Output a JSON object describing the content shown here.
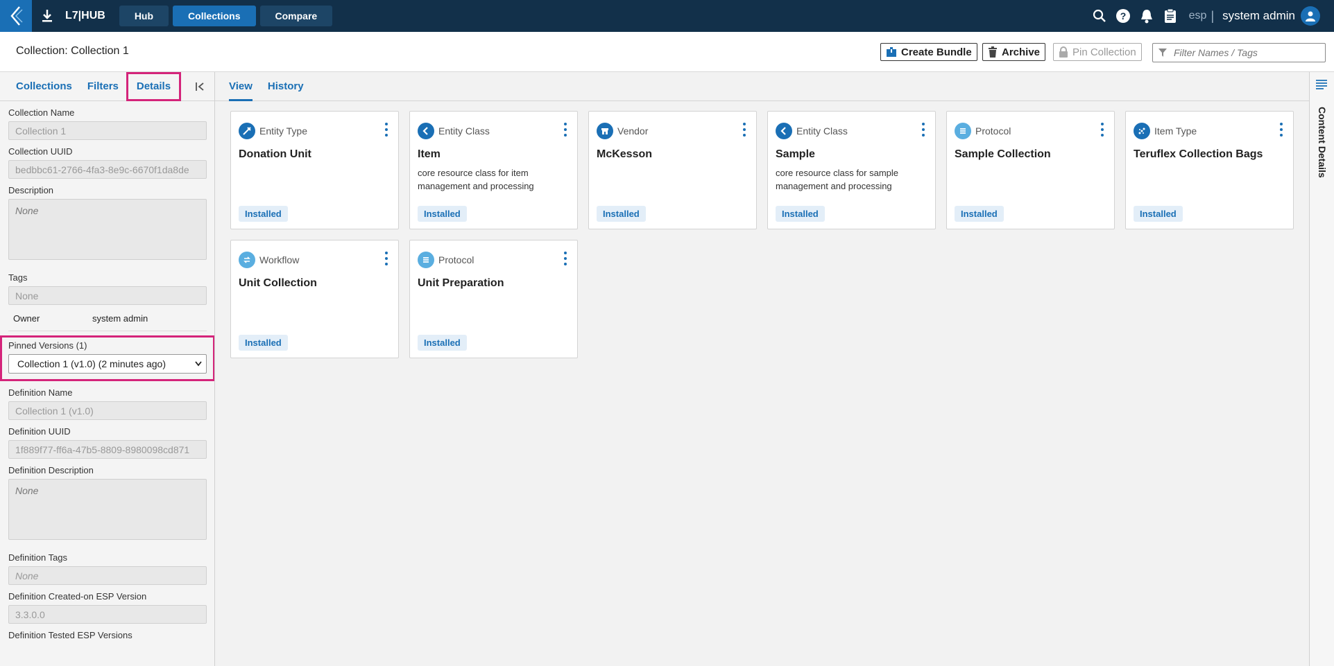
{
  "nav": {
    "brand": "L7|HUB",
    "tabs": [
      {
        "label": "Hub"
      },
      {
        "label": "Collections"
      },
      {
        "label": "Compare"
      }
    ],
    "tenant": "esp",
    "separator": "|",
    "user_name": "system admin"
  },
  "header": {
    "title": "Collection: Collection 1",
    "create_bundle": "Create Bundle",
    "archive": "Archive",
    "pin_collection": "Pin Collection",
    "filter_placeholder": "Filter Names / Tags"
  },
  "left_panel": {
    "tabs": [
      {
        "label": "Collections"
      },
      {
        "label": "Filters"
      },
      {
        "label": "Details"
      }
    ],
    "collection_name_label": "Collection Name",
    "collection_name": "Collection 1",
    "collection_uuid_label": "Collection UUID",
    "collection_uuid": "bedbbc61-2766-4fa3-8e9c-6670f1da8de",
    "description_label": "Description",
    "description": "None",
    "tags_label": "Tags",
    "tags": "None",
    "owner_label": "Owner",
    "owner": "system admin",
    "pinned_label": "Pinned Versions (1)",
    "pinned_selected": "Collection 1 (v1.0) (2 minutes ago)",
    "definition_name_label": "Definition Name",
    "definition_name": "Collection 1 (v1.0)",
    "definition_uuid_label": "Definition UUID",
    "definition_uuid": "1f889f77-ff6a-47b5-8809-8980098cd871",
    "definition_description_label": "Definition Description",
    "definition_description": "None",
    "definition_tags_label": "Definition Tags",
    "definition_tags": "None",
    "definition_created_label": "Definition Created-on ESP Version",
    "definition_created": "3.3.0.0",
    "definition_tested_label": "Definition Tested ESP Versions"
  },
  "main": {
    "tabs": [
      {
        "label": "View"
      },
      {
        "label": "History"
      }
    ],
    "cards": [
      {
        "type": "Entity Type",
        "name": "Donation Unit",
        "desc": "",
        "status": "Installed",
        "icon": "entity-type-icon",
        "color": "#1a6fb5"
      },
      {
        "type": "Entity Class",
        "name": "Item",
        "desc": "core resource class for item management and processing",
        "status": "Installed",
        "icon": "entity-class-icon",
        "color": "#1a6fb5"
      },
      {
        "type": "Vendor",
        "name": "McKesson",
        "desc": "",
        "status": "Installed",
        "icon": "vendor-icon",
        "color": "#1a6fb5"
      },
      {
        "type": "Entity Class",
        "name": "Sample",
        "desc": "core resource class for sample management and processing",
        "status": "Installed",
        "icon": "entity-class-icon",
        "color": "#1a6fb5"
      },
      {
        "type": "Protocol",
        "name": "Sample Collection",
        "desc": "",
        "status": "Installed",
        "icon": "protocol-icon",
        "color": "#5aaee0"
      },
      {
        "type": "Item Type",
        "name": "Teruflex Collection Bags",
        "desc": "",
        "status": "Installed",
        "icon": "item-type-icon",
        "color": "#1a6fb5"
      },
      {
        "type": "Workflow",
        "name": "Unit Collection",
        "desc": "",
        "status": "Installed",
        "icon": "workflow-icon",
        "color": "#5aaee0"
      },
      {
        "type": "Protocol",
        "name": "Unit Preparation",
        "desc": "",
        "status": "Installed",
        "icon": "protocol-icon",
        "color": "#5aaee0"
      }
    ]
  },
  "right_rail": {
    "label": "Content Details"
  },
  "colors": {
    "topbar": "#12304a",
    "accent": "#1a6fb5",
    "highlight": "#d4247a"
  }
}
